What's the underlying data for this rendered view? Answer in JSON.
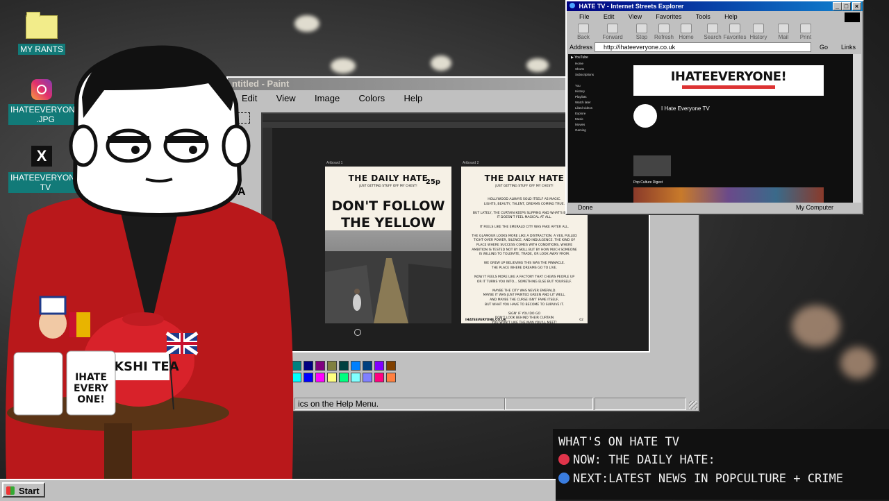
{
  "desktop": {
    "icons": [
      {
        "label": "MY RANTS",
        "icon": "folder-icon"
      },
      {
        "label": "IHATEEVERYONE\n.JPG",
        "icon": "instagram-icon"
      },
      {
        "label": "IHATEEVERYONE\nTV",
        "icon": "x-icon"
      }
    ]
  },
  "paint": {
    "title": "untitled - Paint",
    "title_visible": "ntitled - Paint",
    "menu": [
      "Edit",
      "View",
      "Image",
      "Colors",
      "Help"
    ],
    "status": "ics on the Help Menu.",
    "colors": [
      "#008080",
      "#000080",
      "#800080",
      "#808040",
      "#004040",
      "#0080ff",
      "#004080",
      "#8000ff",
      "#804000",
      "#00ffff",
      "#0000ff",
      "#ff00ff",
      "#ffff80",
      "#00ff80",
      "#80ffff",
      "#8080ff",
      "#ff0080",
      "#ff8040"
    ]
  },
  "poster_left": {
    "artboard": "Artboard 1",
    "title": "THE DAILY HATE",
    "subtitle": "JUST GETTING STUFF OFF MY CHEST!",
    "price": "25p",
    "headline": "DON'T FOLLOW THE YELLOW"
  },
  "poster_right": {
    "artboard": "Artboard 2",
    "title": "THE DAILY HATE",
    "subtitle": "JUST GETTING STUFF OFF MY CHEST!",
    "body": [
      "HOLLYWOOD ALWAYS SOLD ITSELF AS MAGIC.",
      "LIGHTS, BEAUTY, TALENT, DREAMS COMING TRUE.",
      "",
      "BUT LATELY, THE CURTAIN KEEPS SLIPPING AND WHAT'S BEHIND",
      "IT DOESN'T FEEL MAGICAL AT ALL.",
      "",
      "IT FEELS LIKE THE EMERALD CITY WAS FAKE AFTER ALL.",
      "",
      "THE GLAMOUR LOOKS MORE LIKE A DISTRACTION. A VEIL PULLED",
      "TIGHT OVER POWER, SILENCE, AND INDULGENCE. THE KIND OF",
      "PLACE WHERE SUCCESS COMES WITH CONDITIONS, WHERE",
      "AMBITION IS TESTED NOT BY SKILL BUT BY HOW MUCH SOMEONE",
      "IS WILLING TO TOLERATE, TRADE, OR LOOK AWAY FROM.",
      "",
      "WE GREW UP BELIEVING THIS WAS THE PINNACLE.",
      "THE PLACE WHERE DREAMS GO TO LIVE.",
      "",
      "NOW IT FEELS MORE LIKE A FACTORY THAT CHEWS PEOPLE UP",
      "OR IT TURNS YOU INTO... SOMETHING ELSE BUT YOURSELF.",
      "",
      "MAYBE THE CITY WAS NEVER EMERALD.",
      "MAYBE IT WAS JUST PAINTED GREEN AND LIT WELL.",
      "AND MAYBE THE CURSE ISN'T FAME ITSELF,",
      "BUT WHAT YOU HAVE TO BECOME TO SURVIVE IT.",
      "",
      "SIGN' IF YOU DO GO",
      "DON'T LOOK BEHIND THEIR CURTAIN",
      "YOU WON'T LIKE THE MAN YOU'LL MEET!"
    ],
    "footer_left": "IHATEEVERYONE.CO.UK",
    "footer_right": "02"
  },
  "ie": {
    "title": "HATE TV - Internet Streets Explorer",
    "menu": [
      "File",
      "Edit",
      "View",
      "Favorites",
      "Tools",
      "Help"
    ],
    "toolbar": [
      "Back",
      "Forward",
      "Stop",
      "Refresh",
      "Home",
      "Search",
      "Favorites",
      "History",
      "Mail",
      "Print"
    ],
    "address_label": "Address",
    "url": "http://ihateeveryone.co.uk",
    "go": "Go",
    "links": "Links",
    "status_left": "Done",
    "status_right": "My Computer",
    "channel": {
      "banner": "IHATEEVERYONE!",
      "name": "I Hate Everyone TV",
      "section": "Pop Culture Digest"
    }
  },
  "ticker": {
    "heading": "WHAT'S ON HATE TV",
    "now": "NOW: THE DAILY HATE:",
    "next": "NEXT:LATEST NEWS IN POPCULTURE + CRIME",
    "now_color": "#e0344a",
    "next_color": "#3a7de0"
  },
  "taskbar": {
    "start": "Start"
  },
  "props": {
    "mug_text": "IHATE EVERY ONE!",
    "tea_text": "RKSHI TEA"
  }
}
